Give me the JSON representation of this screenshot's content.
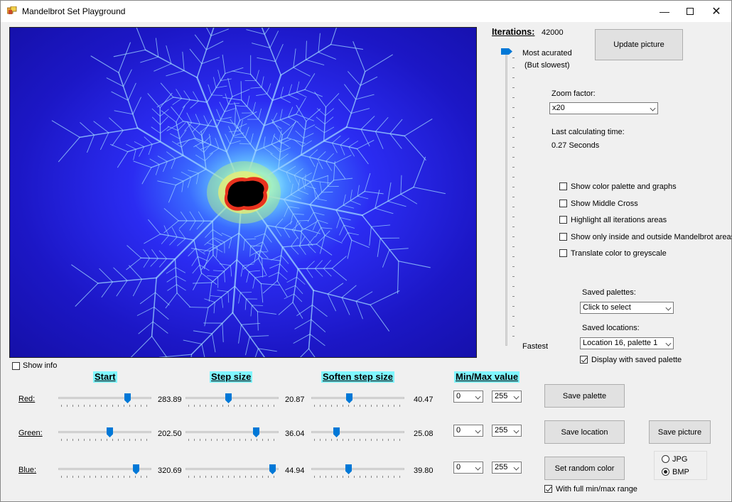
{
  "window": {
    "title": "Mandelbrot Set Playground"
  },
  "iterations": {
    "label": "Iterations:",
    "value": "42000",
    "slider_top_label": "Most acurated",
    "slider_top_sub": "(But slowest)",
    "slider_bottom_label": "Fastest",
    "slider_position_fraction": 0.0
  },
  "update_button": "Update picture",
  "zoom": {
    "label": "Zoom factor:",
    "selected": "x20"
  },
  "calc_time": {
    "label": "Last calculating time:",
    "value": "0.27 Seconds"
  },
  "options": [
    {
      "label": "Show color palette and graphs",
      "checked": false
    },
    {
      "label": "Show Middle Cross",
      "checked": false
    },
    {
      "label": "Highlight all iterations areas",
      "checked": false
    },
    {
      "label": "Show only inside and outside Mandelbrot areas",
      "checked": false
    },
    {
      "label": "Translate color to greyscale",
      "checked": false
    }
  ],
  "saved_palettes": {
    "label": "Saved palettes:",
    "selected": "Click to select"
  },
  "saved_locations": {
    "label": "Saved locations:",
    "selected": "Location 16, palette 1"
  },
  "display_saved_palette": {
    "label": "Display with saved palette",
    "checked": true
  },
  "show_info": {
    "label": "Show info",
    "checked": false
  },
  "columns": {
    "start": "Start",
    "step": "Step size",
    "soften": "Soften step size",
    "minmax": "Min/Max value"
  },
  "rows": [
    {
      "name": "Red:",
      "start": "283.89",
      "step": "20.87",
      "soften": "40.47",
      "start_pos": 0.76,
      "step_pos": 0.46,
      "soften_pos": 0.4,
      "min": "0",
      "max": "255"
    },
    {
      "name": "Green:",
      "start": "202.50",
      "step": "36.04",
      "soften": "25.08",
      "start_pos": 0.56,
      "step_pos": 0.78,
      "soften_pos": 0.25,
      "min": "0",
      "max": "255"
    },
    {
      "name": "Blue:",
      "start": "320.69",
      "step": "44.94",
      "soften": "39.80",
      "start_pos": 0.86,
      "step_pos": 0.97,
      "soften_pos": 0.39,
      "min": "0",
      "max": "255"
    }
  ],
  "buttons": {
    "save_palette": "Save  palette",
    "save_location": "Save location",
    "save_picture": "Save picture",
    "random_color": "Set random color"
  },
  "full_range": {
    "label": "With full min/max range",
    "checked": true
  },
  "format": {
    "jpg": "JPG",
    "bmp": "BMP",
    "selected": "BMP"
  },
  "colors": {
    "accent": "#0078d7",
    "header_bg": "#7ff6ff",
    "window_bg": "#f0f0f0",
    "fractal_outer": "#1c17c6",
    "fractal_glow": "#8fe8ff"
  }
}
